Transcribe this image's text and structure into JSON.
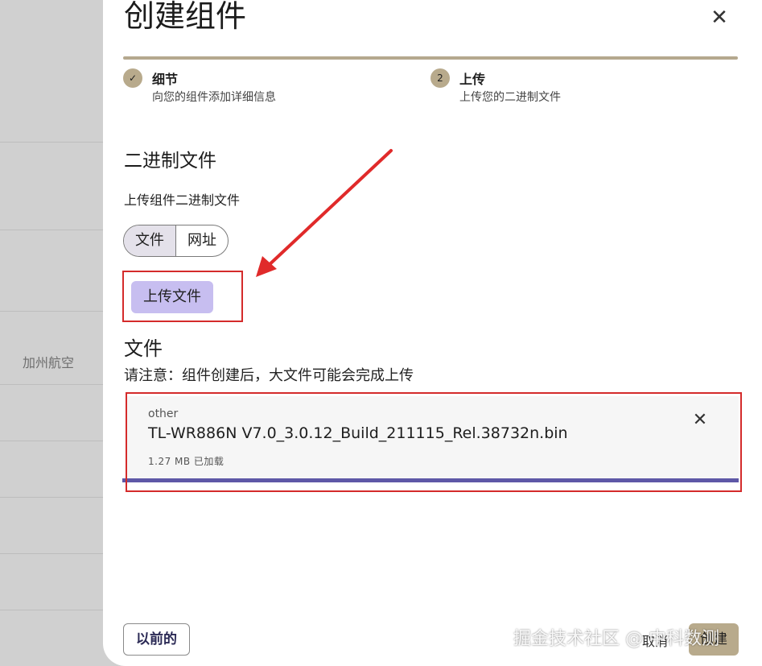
{
  "background": {
    "side_label": "加州航空"
  },
  "modal": {
    "title": "创建组件",
    "close_icon": "close-icon",
    "steps": [
      {
        "marker": "✓",
        "title": "细节",
        "subtitle": "向您的组件添加详细信息"
      },
      {
        "marker": "2",
        "title": "上传",
        "subtitle": "上传您的二进制文件"
      }
    ],
    "section_heading": "二进制文件",
    "section_subtitle": "上传组件二进制文件",
    "source_toggle": {
      "options": [
        "文件",
        "网址"
      ],
      "selected": "文件"
    },
    "upload_button": "上传文件",
    "files_heading": "文件",
    "files_note": "请注意：组件创建后，大文件可能会完成上传",
    "file": {
      "type": "other",
      "name": "TL-WR886N V7.0_3.0.12_Build_211115_Rel.38732n.bin",
      "size_status": "1.27 MB 已加载",
      "progress_percent": 100
    },
    "footer": {
      "previous_button": "以前的",
      "cancel_button": "取消",
      "create_button": "创建"
    }
  },
  "watermark": "掘金技术社区 @ 中科数测",
  "colors": {
    "accent_gold": "#b8aa8c",
    "upload_button": "#c7bef0",
    "progress": "#5e58a7",
    "annotation_red": "#d42b2b"
  }
}
